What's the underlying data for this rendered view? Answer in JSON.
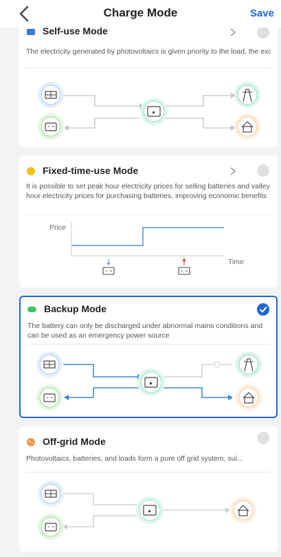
{
  "nav": {
    "title": "Charge Mode",
    "save_label": "Save"
  },
  "modes": [
    {
      "title": "Self-use Mode",
      "description": "The electricity generated by photovoltaics is given priority to the load, the excess electricity is used to charge the battery, and the r...",
      "selected": false
    },
    {
      "title": "Fixed-time-use Mode",
      "description": "It is possible to set peak hour electricity prices for selling batteries and valley hour electricity prices for purchasing batteries, improving economic benefits",
      "selected": false,
      "chart": {
        "ylabel": "Price",
        "xlabel": "Time"
      }
    },
    {
      "title": "Backup Mode",
      "description": "The battery can only be discharged under abnormal mains conditions and can be used as an emergency power source",
      "selected": true
    },
    {
      "title": "Off-grid Mode",
      "description": "Photovoltaics, batteries, and loads form a pure off grid system, sui...",
      "selected": false
    }
  ],
  "colors": {
    "accent": "#1e66d6",
    "solar": "#6aa8e8",
    "battery": "#7ccf6f",
    "inverter": "#5fd0a0",
    "grid": "#3fb8a0",
    "load": "#f0b070"
  },
  "icons": {
    "back": "chevron-left-icon",
    "solar": "solar-panel-icon",
    "battery": "battery-icon",
    "inverter": "inverter-icon",
    "grid": "grid-tower-icon",
    "load": "home-icon"
  }
}
